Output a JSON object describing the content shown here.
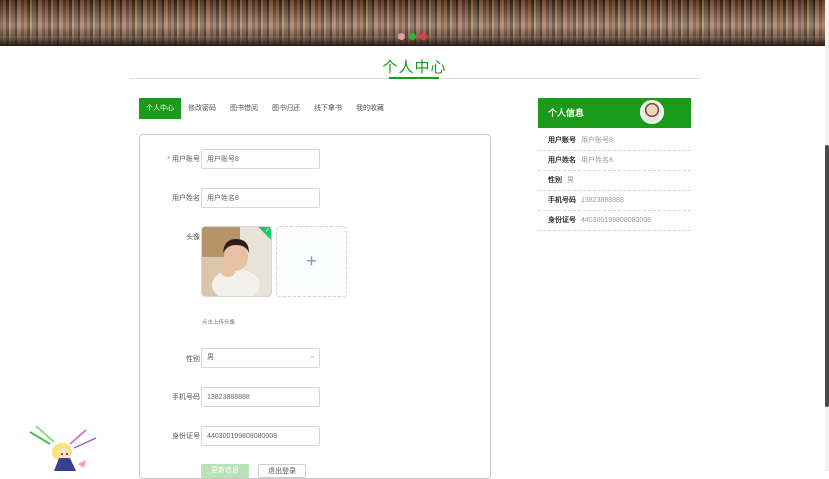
{
  "page": {
    "title": "个人中心"
  },
  "colors": {
    "accent": "#1a9b1a",
    "dots": [
      "#e0a0a0",
      "#2fb42f",
      "#e04040"
    ]
  },
  "tabs": [
    {
      "label": "个人中心",
      "active": true
    },
    {
      "label": "修改密码",
      "active": false
    },
    {
      "label": "图书借阅",
      "active": false
    },
    {
      "label": "图书归还",
      "active": false
    },
    {
      "label": "线下拿书",
      "active": false
    },
    {
      "label": "我的收藏",
      "active": false
    }
  ],
  "form": {
    "account": {
      "label": "用户账号",
      "required_mark": "*",
      "value": "用户账号8"
    },
    "name": {
      "label": "用户姓名",
      "value": "用户姓名8"
    },
    "avatar": {
      "label": "头像",
      "upload_icon": "plus-icon",
      "upload_glyph": "+",
      "hint": "点击上传头像",
      "check_glyph": "✓"
    },
    "gender": {
      "label": "性别",
      "value": "男",
      "arrow": "⌄"
    },
    "phone": {
      "label": "手机号码",
      "value": "13823888888"
    },
    "idcard": {
      "label": "身份证号",
      "value": "440300199808080008"
    },
    "buttons": {
      "update": "更新信息",
      "logout": "退出登录"
    }
  },
  "info": {
    "header": "个人信息",
    "rows": [
      {
        "label": "用户账号",
        "value": "用户账号8"
      },
      {
        "label": "用户姓名",
        "value": "用户姓名8"
      },
      {
        "label": "性别",
        "value": "男"
      },
      {
        "label": "手机号码",
        "value": "13823888888"
      },
      {
        "label": "身份证号",
        "value": "440300199808080008"
      }
    ]
  }
}
